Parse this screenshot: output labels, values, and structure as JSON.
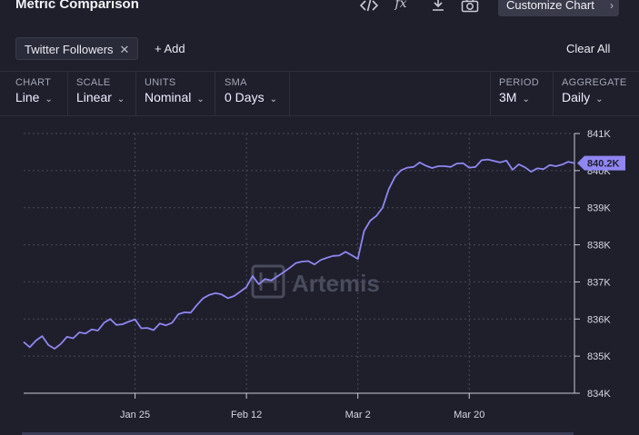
{
  "header": {
    "title": "Metric Comparison",
    "icons": [
      "code-icon",
      "function-icon",
      "download-icon",
      "camera-icon"
    ],
    "fx_label": "fx",
    "customize_label": "Customize Chart"
  },
  "tags": {
    "metric_tag": "Twitter Followers",
    "add_label": "+ Add",
    "clear_label": "Clear All"
  },
  "controls": {
    "chart": {
      "label": "CHART",
      "value": "Line"
    },
    "scale": {
      "label": "SCALE",
      "value": "Linear"
    },
    "units": {
      "label": "UNITS",
      "value": "Nominal"
    },
    "sma": {
      "label": "SMA",
      "value": "0 Days"
    },
    "period": {
      "label": "PERIOD",
      "value": "3M"
    },
    "aggregate": {
      "label": "AGGREGATE",
      "value": "Daily"
    }
  },
  "watermark": "Artemis",
  "colors": {
    "background": "#1e1f2b",
    "line": "#8f86f2",
    "grid": "#4a4b5a",
    "badge": "#8f86f2"
  },
  "chart_data": {
    "type": "line",
    "title": "",
    "xlabel": "",
    "ylabel": "",
    "ylim": [
      834000,
      841000
    ],
    "y_ticks": [
      {
        "value": 834000,
        "label": "834K"
      },
      {
        "value": 835000,
        "label": "835K"
      },
      {
        "value": 836000,
        "label": "836K"
      },
      {
        "value": 837000,
        "label": "837K"
      },
      {
        "value": 838000,
        "label": "838K"
      },
      {
        "value": 839000,
        "label": "839K"
      },
      {
        "value": 840000,
        "label": "840K"
      },
      {
        "value": 841000,
        "label": "841K"
      }
    ],
    "x_ticks": [
      {
        "date": "2025-01-25",
        "label": "Jan 25"
      },
      {
        "date": "2025-02-12",
        "label": "Feb 12"
      },
      {
        "date": "2025-03-02",
        "label": "Mar 2"
      },
      {
        "date": "2025-03-20",
        "label": "Mar 20"
      }
    ],
    "grid": true,
    "last_value_label": "840.2K",
    "series": [
      {
        "name": "Twitter Followers",
        "x": [
          "2025-01-07",
          "2025-01-08",
          "2025-01-09",
          "2025-01-10",
          "2025-01-11",
          "2025-01-12",
          "2025-01-13",
          "2025-01-14",
          "2025-01-15",
          "2025-01-16",
          "2025-01-17",
          "2025-01-18",
          "2025-01-19",
          "2025-01-20",
          "2025-01-21",
          "2025-01-22",
          "2025-01-23",
          "2025-01-24",
          "2025-01-25",
          "2025-01-26",
          "2025-01-27",
          "2025-01-28",
          "2025-01-29",
          "2025-01-30",
          "2025-01-31",
          "2025-02-01",
          "2025-02-02",
          "2025-02-03",
          "2025-02-04",
          "2025-02-05",
          "2025-02-06",
          "2025-02-07",
          "2025-02-08",
          "2025-02-09",
          "2025-02-10",
          "2025-02-11",
          "2025-02-12",
          "2025-02-13",
          "2025-02-14",
          "2025-02-15",
          "2025-02-16",
          "2025-02-17",
          "2025-02-18",
          "2025-02-19",
          "2025-02-20",
          "2025-02-21",
          "2025-02-22",
          "2025-02-23",
          "2025-02-24",
          "2025-02-25",
          "2025-02-26",
          "2025-02-27",
          "2025-02-28",
          "2025-03-01",
          "2025-03-02",
          "2025-03-03",
          "2025-03-04",
          "2025-03-05",
          "2025-03-06",
          "2025-03-07",
          "2025-03-08",
          "2025-03-09",
          "2025-03-10",
          "2025-03-11",
          "2025-03-12",
          "2025-03-13",
          "2025-03-14",
          "2025-03-15",
          "2025-03-16",
          "2025-03-17",
          "2025-03-18",
          "2025-03-19",
          "2025-03-20",
          "2025-03-21",
          "2025-03-22",
          "2025-03-23",
          "2025-03-24",
          "2025-03-25",
          "2025-03-26",
          "2025-03-27",
          "2025-03-28",
          "2025-03-29",
          "2025-03-30",
          "2025-03-31",
          "2025-04-01",
          "2025-04-02",
          "2025-04-03",
          "2025-04-04",
          "2025-04-05",
          "2025-04-06"
        ],
        "values": [
          835380,
          835240,
          835420,
          835540,
          835300,
          835200,
          835330,
          835520,
          835480,
          835640,
          835610,
          835720,
          835690,
          835900,
          836000,
          835840,
          835860,
          835930,
          835990,
          835750,
          835760,
          835700,
          835880,
          835830,
          835900,
          836130,
          836180,
          836170,
          836380,
          836560,
          836650,
          836700,
          836660,
          836560,
          836620,
          836740,
          836860,
          837160,
          836940,
          837080,
          837040,
          837150,
          837260,
          837380,
          837510,
          837550,
          837560,
          837470,
          837590,
          837650,
          837700,
          837710,
          837810,
          837720,
          837620,
          838370,
          838650,
          838780,
          839000,
          839500,
          839830,
          840010,
          840080,
          840100,
          840220,
          840130,
          840070,
          840120,
          840120,
          840100,
          840190,
          840200,
          840080,
          840100,
          840280,
          840300,
          840260,
          840220,
          840270,
          840020,
          840170,
          840090,
          839970,
          840060,
          840040,
          840150,
          840120,
          840160,
          840240,
          840200
        ]
      }
    ]
  }
}
